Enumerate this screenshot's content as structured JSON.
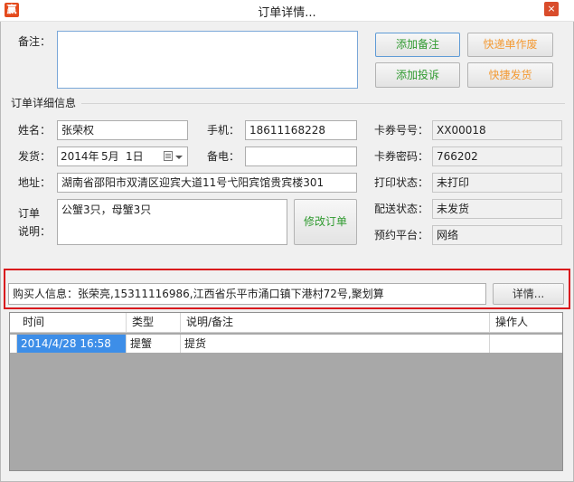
{
  "window": {
    "title": "订单详情...",
    "app_icon": "赢",
    "close": "×"
  },
  "remark": {
    "label": "备注：",
    "value": ""
  },
  "buttons": {
    "add_remark": "添加备注",
    "quick_void": "快递单作废",
    "add_complaint": "添加投诉",
    "quick_ship": "快捷发货",
    "modify_order": "修改订单",
    "details": "详情..."
  },
  "detail_section": {
    "title": "订单详细信息"
  },
  "fields": {
    "name": {
      "label": "姓名：",
      "value": "张荣权"
    },
    "phone": {
      "label": "手机：",
      "value": "18611168228"
    },
    "card_no": {
      "label": "卡券号号：",
      "value": "XX00018"
    },
    "ship_date": {
      "label": "发货：",
      "year": "2014年",
      "month": "5月",
      "day": "1日"
    },
    "backup_phone": {
      "label": "备电：",
      "value": ""
    },
    "card_password": {
      "label": "卡券密码：",
      "value": "766202"
    },
    "address": {
      "label": "地址：",
      "value": "湖南省邵阳市双清区迎宾大道11号弋阳宾馆贵宾楼301"
    },
    "print_status": {
      "label": "打印状态：",
      "value": "未打印"
    },
    "order_note": {
      "label_line1": "订单",
      "label_line2": "说明：",
      "value": "公蟹3只，母蟹3只"
    },
    "delivery_status": {
      "label": "配送状态：",
      "value": "未发货"
    },
    "booking_platform": {
      "label": "预约平台：",
      "value": "网络"
    }
  },
  "buyer": {
    "value": "购买人信息：张荣亮,15311116986,江西省乐平市涌口镇下港村72号,聚划算"
  },
  "table": {
    "columns": [
      "时间",
      "类型",
      "说明/备注",
      "操作人"
    ],
    "rows": [
      {
        "time": "2014/4/28 16:58",
        "type": "提蟹",
        "note": "提货",
        "operator": ""
      }
    ]
  },
  "icons": [
    "app-logo-icon",
    "close-icon",
    "calendar-icon",
    "chevron-down-icon"
  ],
  "colors": {
    "accent_red": "#d9191d",
    "button_green": "#2f9a2f",
    "button_orange": "#f39a34",
    "selection_blue": "#3d8ee8"
  }
}
